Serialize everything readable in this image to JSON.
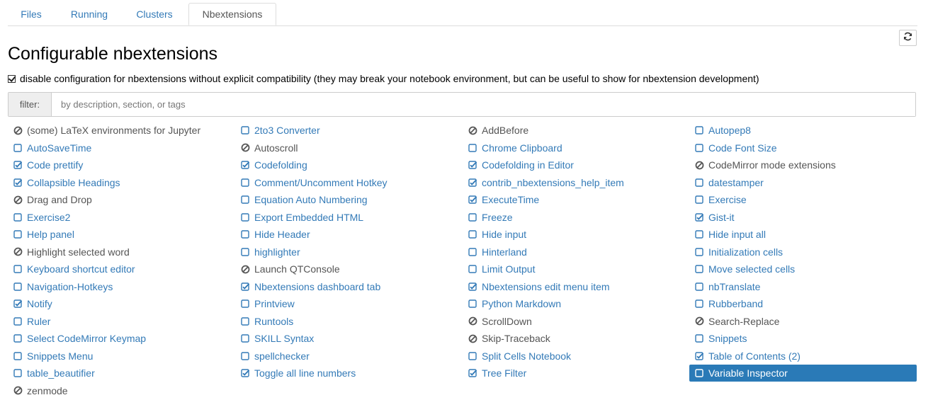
{
  "tabs": [
    {
      "label": "Files",
      "active": false
    },
    {
      "label": "Running",
      "active": false
    },
    {
      "label": "Clusters",
      "active": false
    },
    {
      "label": "Nbextensions",
      "active": true
    }
  ],
  "page_title": "Configurable nbextensions",
  "compat_checkbox": {
    "checked": true,
    "label": "disable configuration for nbextensions without explicit compatibility (they may break your notebook environment, but can be useful to show for nbextension development)"
  },
  "filter": {
    "label": "filter:",
    "placeholder": "by description, section, or tags",
    "value": ""
  },
  "icons": {
    "refresh": "refresh-icon",
    "unchecked": "square-icon",
    "checked": "check-square-icon",
    "incompatible": "ban-icon"
  },
  "colors": {
    "link": "#337ab7",
    "selected_bg": "#2a7ab7",
    "incompatible_text": "#555555"
  },
  "extensions": [
    {
      "label": "(some) LaTeX environments for Jupyter",
      "state": "incompatible"
    },
    {
      "label": "2to3 Converter",
      "state": "unchecked"
    },
    {
      "label": "AddBefore",
      "state": "incompatible"
    },
    {
      "label": "Autopep8",
      "state": "unchecked"
    },
    {
      "label": "AutoSaveTime",
      "state": "unchecked"
    },
    {
      "label": "Autoscroll",
      "state": "incompatible"
    },
    {
      "label": "Chrome Clipboard",
      "state": "unchecked"
    },
    {
      "label": "Code Font Size",
      "state": "unchecked"
    },
    {
      "label": "Code prettify",
      "state": "checked"
    },
    {
      "label": "Codefolding",
      "state": "checked"
    },
    {
      "label": "Codefolding in Editor",
      "state": "checked"
    },
    {
      "label": "CodeMirror mode extensions",
      "state": "incompatible"
    },
    {
      "label": "Collapsible Headings",
      "state": "checked"
    },
    {
      "label": "Comment/Uncomment Hotkey",
      "state": "unchecked"
    },
    {
      "label": "contrib_nbextensions_help_item",
      "state": "checked"
    },
    {
      "label": "datestamper",
      "state": "unchecked"
    },
    {
      "label": "Drag and Drop",
      "state": "incompatible"
    },
    {
      "label": "Equation Auto Numbering",
      "state": "unchecked"
    },
    {
      "label": "ExecuteTime",
      "state": "checked"
    },
    {
      "label": "Exercise",
      "state": "unchecked"
    },
    {
      "label": "Exercise2",
      "state": "unchecked"
    },
    {
      "label": "Export Embedded HTML",
      "state": "unchecked"
    },
    {
      "label": "Freeze",
      "state": "unchecked"
    },
    {
      "label": "Gist-it",
      "state": "checked"
    },
    {
      "label": "Help panel",
      "state": "unchecked"
    },
    {
      "label": "Hide Header",
      "state": "unchecked"
    },
    {
      "label": "Hide input",
      "state": "unchecked"
    },
    {
      "label": "Hide input all",
      "state": "unchecked"
    },
    {
      "label": "Highlight selected word",
      "state": "incompatible"
    },
    {
      "label": "highlighter",
      "state": "unchecked"
    },
    {
      "label": "Hinterland",
      "state": "unchecked"
    },
    {
      "label": "Initialization cells",
      "state": "unchecked"
    },
    {
      "label": "Keyboard shortcut editor",
      "state": "unchecked"
    },
    {
      "label": "Launch QTConsole",
      "state": "incompatible"
    },
    {
      "label": "Limit Output",
      "state": "unchecked"
    },
    {
      "label": "Move selected cells",
      "state": "unchecked"
    },
    {
      "label": "Navigation-Hotkeys",
      "state": "unchecked"
    },
    {
      "label": "Nbextensions dashboard tab",
      "state": "checked"
    },
    {
      "label": "Nbextensions edit menu item",
      "state": "checked"
    },
    {
      "label": "nbTranslate",
      "state": "unchecked"
    },
    {
      "label": "Notify",
      "state": "checked"
    },
    {
      "label": "Printview",
      "state": "unchecked"
    },
    {
      "label": "Python Markdown",
      "state": "unchecked"
    },
    {
      "label": "Rubberband",
      "state": "unchecked"
    },
    {
      "label": "Ruler",
      "state": "unchecked"
    },
    {
      "label": "Runtools",
      "state": "unchecked"
    },
    {
      "label": "ScrollDown",
      "state": "incompatible"
    },
    {
      "label": "Search-Replace",
      "state": "incompatible"
    },
    {
      "label": "Select CodeMirror Keymap",
      "state": "unchecked"
    },
    {
      "label": "SKILL Syntax",
      "state": "unchecked"
    },
    {
      "label": "Skip-Traceback",
      "state": "incompatible"
    },
    {
      "label": "Snippets",
      "state": "unchecked"
    },
    {
      "label": "Snippets Menu",
      "state": "unchecked"
    },
    {
      "label": "spellchecker",
      "state": "unchecked"
    },
    {
      "label": "Split Cells Notebook",
      "state": "unchecked"
    },
    {
      "label": "Table of Contents (2)",
      "state": "checked"
    },
    {
      "label": "table_beautifier",
      "state": "unchecked"
    },
    {
      "label": "Toggle all line numbers",
      "state": "checked"
    },
    {
      "label": "Tree Filter",
      "state": "checked"
    },
    {
      "label": "Variable Inspector",
      "state": "unchecked",
      "selected": true
    },
    {
      "label": "zenmode",
      "state": "incompatible"
    }
  ]
}
